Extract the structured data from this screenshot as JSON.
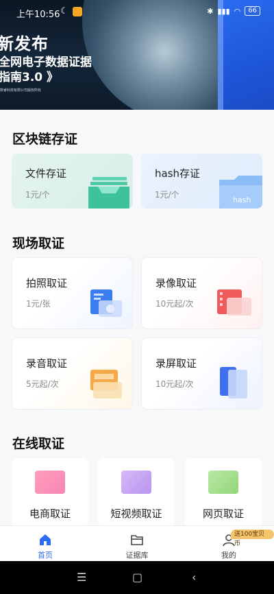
{
  "status_bar": {
    "time": "上午10:56",
    "battery": "66"
  },
  "banner": {
    "headline": "新发布",
    "line1": "全网电子数据证据",
    "line2": "指南3.0 》",
    "copyright": "数睿科技有限公司版权所有"
  },
  "sections": {
    "blockchain": {
      "title": "区块链存证",
      "cards": [
        {
          "name": "文件存证",
          "price": "1元/个"
        },
        {
          "name": "hash存证",
          "price": "1元/个",
          "tag": "hash"
        }
      ]
    },
    "onsite": {
      "title": "现场取证",
      "cards": [
        {
          "name": "拍照取证",
          "price": "1元/张"
        },
        {
          "name": "录像取证",
          "price": "10元起/次"
        },
        {
          "name": "录音取证",
          "price": "5元起/次"
        },
        {
          "name": "录屏取证",
          "price": "10元起/次"
        }
      ]
    },
    "online": {
      "title": "在线取证",
      "cards": [
        {
          "name": "电商取证"
        },
        {
          "name": "短视频取证"
        },
        {
          "name": "网页取证"
        }
      ]
    }
  },
  "tabbar": {
    "items": [
      {
        "label": "首页",
        "active": true
      },
      {
        "label": "证据库",
        "active": false
      },
      {
        "label": "我的",
        "active": false
      }
    ],
    "badge": "送100宝贝币"
  },
  "colors": {
    "accent": "#2f6cf6"
  }
}
